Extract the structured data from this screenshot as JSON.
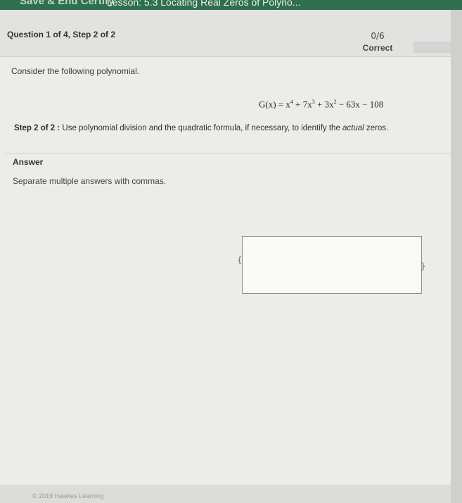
{
  "topbar": {
    "save_label": "Save & End Certify",
    "lesson_title": "Lesson: 5.3 Locating Real Zeros of Polyno..."
  },
  "question": {
    "title": "Question 1 of 4, Step 2 of 2",
    "score": "0/6",
    "status": "Correct",
    "prompt": "Consider the following polynomial.",
    "equation": {
      "lhs": "G(x) = x",
      "p1": "4",
      "t2": " + 7x",
      "p2": "3",
      "t3": " + 3x",
      "p3": "2",
      "t4": " − 63x − 108"
    },
    "step_label": "Step 2 of 2 :",
    "step_text_before": " Use polynomial division and the quadratic formula, if necessary, to identify the ",
    "step_text_emph": "actual",
    "step_text_after": " zeros."
  },
  "answer": {
    "title": "Answer",
    "hint": "Separate multiple answers with commas.",
    "value": "",
    "left_bracket": "{",
    "right_bracket": "}"
  },
  "footer": {
    "copyright": "© 2019 Hawkes Learning"
  }
}
